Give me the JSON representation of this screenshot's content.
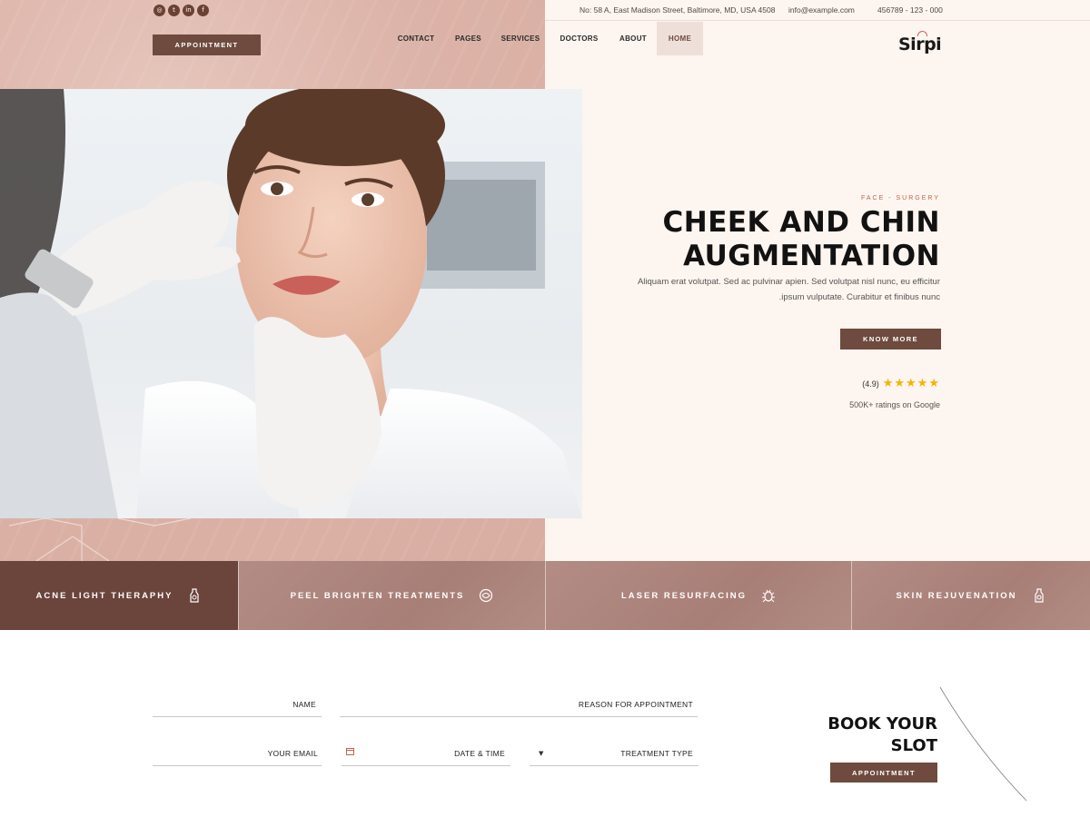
{
  "topbar": {
    "social_icons": [
      "instagram-icon",
      "twitter-icon",
      "linkedin-icon",
      "facebook-icon"
    ],
    "address": "No: 58 A, East Madison Street, Baltimore, MD, USA 4508",
    "email": "info@example.com",
    "phone": "456789 - 123 - 000"
  },
  "header": {
    "appointment_label": "APPOINTMENT",
    "nav": [
      "CONTACT",
      "PAGES",
      "SERVICES",
      "DOCTORS",
      "ABOUT",
      "HOME"
    ],
    "active_nav": "HOME",
    "logo": "Sirpi"
  },
  "hero": {
    "eyebrow": "FACE - SURGERY",
    "title_line1": "CHEEK AND CHIN",
    "title_line2": "AUGMENTATION",
    "lead_line1": "Aliquam erat volutpat. Sed ac pulvinar apien. Sed volutpat nisl nunc, eu efficitur",
    "lead_line2": ".ipsum vulputate. Curabitur et finibus nunc",
    "cta": "KNOW MORE",
    "rating_value": "(4.9)",
    "rating": 4.9,
    "rating_text": "500K+ ratings on Google"
  },
  "services": [
    {
      "label": "ACNE LIGHT THERAPHY",
      "icon": "bottle-icon"
    },
    {
      "label": "PEEL BRIGHTEN TREATMENTS",
      "icon": "refresh-icon"
    },
    {
      "label": "LASER RESURFACING",
      "icon": "bug-icon"
    },
    {
      "label": "SKIN REJUVENATION",
      "icon": "bottle-icon"
    }
  ],
  "booking": {
    "name_label": "NAME",
    "reason_label": "REASON FOR APPOINTMENT",
    "email_label": "YOUR EMAIL",
    "datetime_label": "DATE & TIME",
    "treatment_label": "TREATMENT TYPE",
    "title_line1": "BOOK YOUR",
    "title_line2": "SLOT",
    "button": "APPOINTMENT"
  },
  "colors": {
    "brand": "#6e4b3e",
    "accent": "#c0644e",
    "star": "#f5b400",
    "left_bg": "#dcb3a8",
    "right_bg": "#fdf5f0"
  }
}
